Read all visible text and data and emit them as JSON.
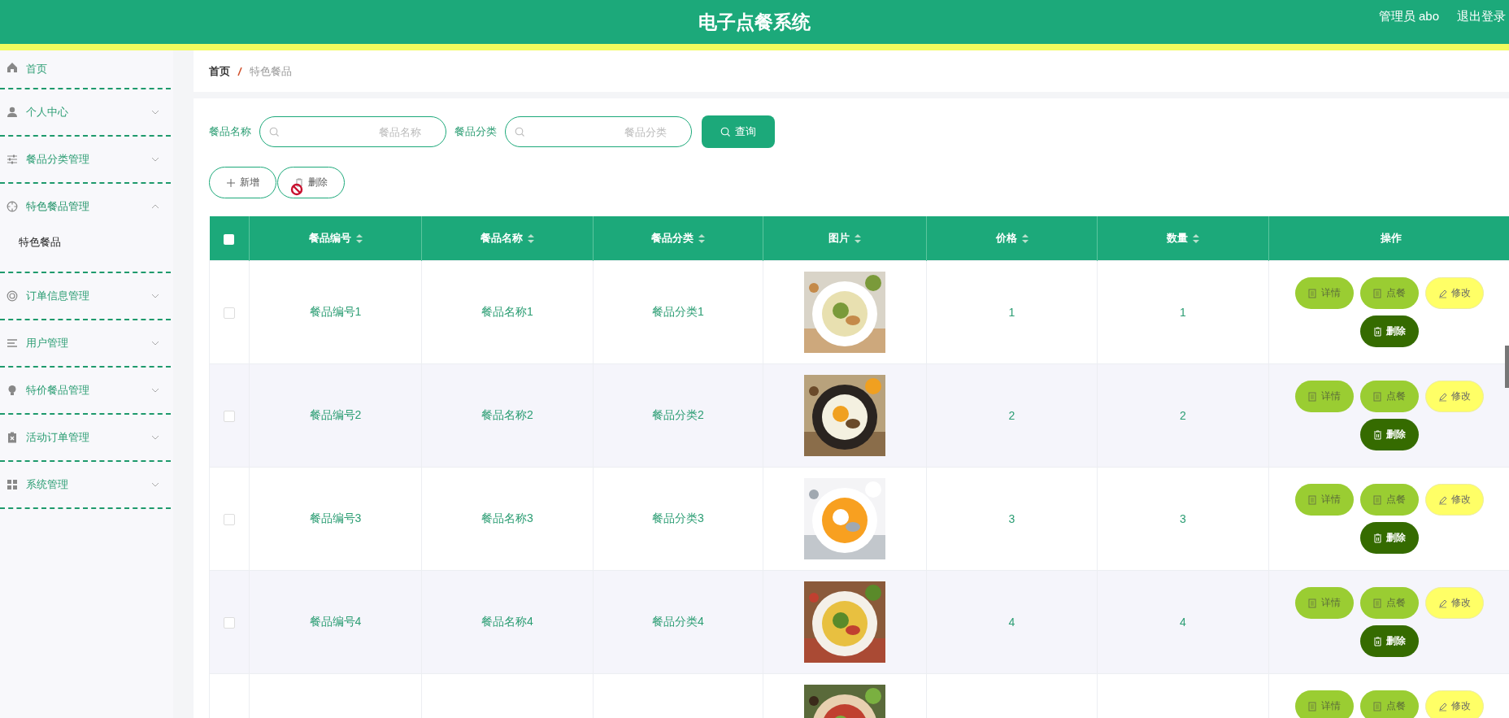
{
  "header": {
    "title": "电子点餐系统",
    "user": "管理员 abo",
    "logout": "退出登录"
  },
  "sidebar": {
    "items": [
      {
        "kind": "link",
        "label": "首页"
      },
      {
        "kind": "submenu",
        "label": "个人中心",
        "expanded": false
      },
      {
        "kind": "submenu",
        "label": "餐品分类管理",
        "expanded": false
      },
      {
        "kind": "submenu",
        "label": "特色餐品管理",
        "expanded": true,
        "children": [
          {
            "label": "特色餐品"
          }
        ]
      },
      {
        "kind": "submenu",
        "label": "订单信息管理",
        "expanded": false
      },
      {
        "kind": "submenu",
        "label": "用户管理",
        "expanded": false
      },
      {
        "kind": "submenu",
        "label": "特价餐品管理",
        "expanded": false
      },
      {
        "kind": "submenu",
        "label": "活动订单管理",
        "expanded": false
      },
      {
        "kind": "submenu",
        "label": "系统管理",
        "expanded": false
      }
    ]
  },
  "breadcrumb": [
    "首页",
    "特色餐品"
  ],
  "search": {
    "fields": [
      {
        "label": "餐品名称",
        "placeholder": "餐品名称"
      },
      {
        "label": "餐品分类",
        "placeholder": "餐品分类"
      }
    ],
    "button": "查询"
  },
  "toolbar": [
    {
      "kind": "add",
      "label": "新增"
    },
    {
      "kind": "delete",
      "label": "删除"
    }
  ],
  "table": {
    "all_checked": false,
    "columns": [
      {
        "label": "餐品编号",
        "sortable": true
      },
      {
        "label": "餐品名称",
        "sortable": true
      },
      {
        "label": "餐品分类",
        "sortable": true
      },
      {
        "label": "图片",
        "sortable": true
      },
      {
        "label": "价格",
        "sortable": true
      },
      {
        "label": "数量",
        "sortable": true
      },
      {
        "label": "操作",
        "sortable": false
      }
    ],
    "rows": [
      {
        "checked": false,
        "cells": [
          "餐品编号1",
          "餐品名称1",
          "餐品分类1"
        ],
        "picture": {
          "kind": "picture"
        },
        "price": "1",
        "quantity": "1",
        "actions": [
          {
            "kind": "detail",
            "label": "详情"
          },
          {
            "kind": "order",
            "label": "点餐"
          },
          {
            "kind": "edit",
            "label": "修改"
          },
          {
            "kind": "delete",
            "label": "删除"
          }
        ]
      },
      {
        "checked": false,
        "cells": [
          "餐品编号2",
          "餐品名称2",
          "餐品分类2"
        ],
        "picture": {
          "kind": "picture"
        },
        "price": "2",
        "quantity": "2",
        "actions": [
          {
            "kind": "detail",
            "label": "详情"
          },
          {
            "kind": "order",
            "label": "点餐"
          },
          {
            "kind": "edit",
            "label": "修改"
          },
          {
            "kind": "delete",
            "label": "删除"
          }
        ]
      },
      {
        "checked": false,
        "cells": [
          "餐品编号3",
          "餐品名称3",
          "餐品分类3"
        ],
        "picture": {
          "kind": "picture"
        },
        "price": "3",
        "quantity": "3",
        "actions": [
          {
            "kind": "detail",
            "label": "详情"
          },
          {
            "kind": "order",
            "label": "点餐"
          },
          {
            "kind": "edit",
            "label": "修改"
          },
          {
            "kind": "delete",
            "label": "删除"
          }
        ]
      },
      {
        "checked": false,
        "cells": [
          "餐品编号4",
          "餐品名称4",
          "餐品分类4"
        ],
        "picture": {
          "kind": "picture"
        },
        "price": "4",
        "quantity": "4",
        "actions": [
          {
            "kind": "detail",
            "label": "详情"
          },
          {
            "kind": "order",
            "label": "点餐"
          },
          {
            "kind": "edit",
            "label": "修改"
          },
          {
            "kind": "delete",
            "label": "删除"
          }
        ]
      },
      {
        "picture": {
          "kind": "picture"
        },
        "actions": [
          {
            "kind": "detail",
            "label": "详情"
          },
          {
            "kind": "order",
            "label": "点餐"
          },
          {
            "kind": "edit",
            "label": "修改"
          }
        ]
      }
    ]
  }
}
